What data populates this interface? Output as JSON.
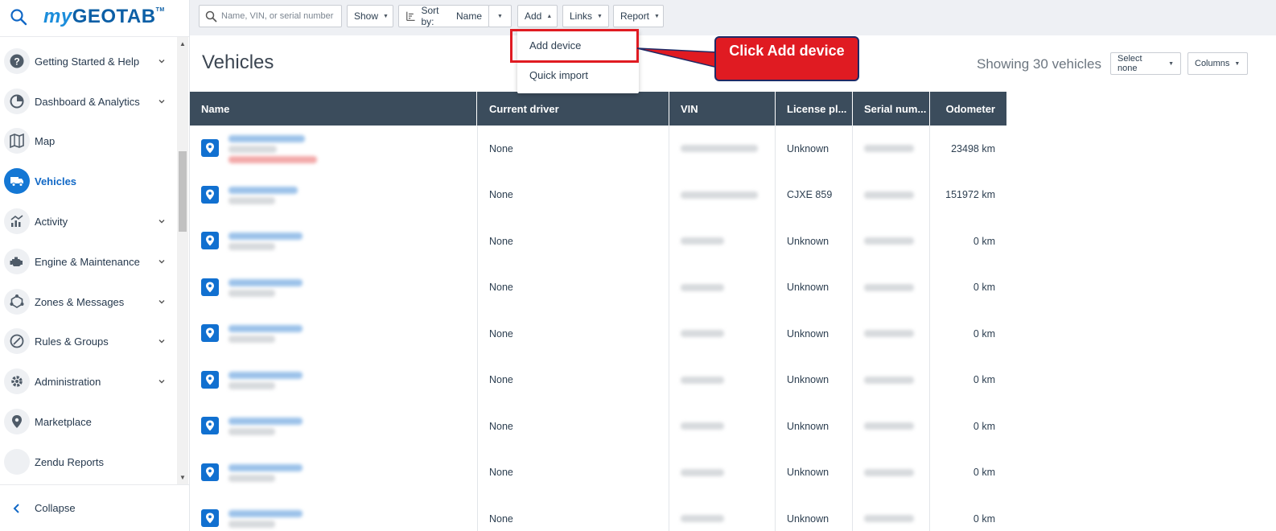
{
  "app": {
    "logo_prefix": "my",
    "logo_main": "GEOTAB",
    "logo_tm": "TM"
  },
  "sidebar": {
    "items": [
      {
        "label": "Getting Started & Help",
        "icon": "help-icon",
        "chevron": true
      },
      {
        "label": "Dashboard & Analytics",
        "icon": "pie-chart-icon",
        "chevron": true
      },
      {
        "label": "Map",
        "icon": "map-icon",
        "chevron": false
      },
      {
        "label": "Vehicles",
        "icon": "truck-icon",
        "chevron": false,
        "active": true
      },
      {
        "label": "Activity",
        "icon": "activity-chart-icon",
        "chevron": true
      },
      {
        "label": "Engine & Maintenance",
        "icon": "engine-icon",
        "chevron": true
      },
      {
        "label": "Zones & Messages",
        "icon": "zones-icon",
        "chevron": true
      },
      {
        "label": "Rules & Groups",
        "icon": "rules-icon",
        "chevron": true
      },
      {
        "label": "Administration",
        "icon": "gear-icon",
        "chevron": true
      },
      {
        "label": "Marketplace",
        "icon": "marketplace-icon",
        "chevron": false
      },
      {
        "label": "Zendu Reports",
        "icon": "blank-icon",
        "chevron": false
      }
    ],
    "collapse_label": "Collapse"
  },
  "toolbar": {
    "search_placeholder": "Name, VIN, or serial number",
    "show_label": "Show",
    "sort_prefix": "Sort by:",
    "sort_value": "Name",
    "add_label": "Add",
    "links_label": "Links",
    "report_label": "Report"
  },
  "add_menu": {
    "items": [
      "Add device",
      "Quick import"
    ]
  },
  "callout": {
    "text": "Click Add device",
    "color": "#e01b22"
  },
  "page": {
    "title": "Vehicles",
    "showing": "Showing 30 vehicles",
    "select_none_label": "Select none",
    "columns_label": "Columns"
  },
  "table": {
    "headers": [
      "Name",
      "Current driver",
      "VIN",
      "License pl...",
      "Serial num...",
      "Odometer"
    ],
    "rows": [
      {
        "driver": "None",
        "plate": "Unknown",
        "odometer": "23498 km"
      },
      {
        "driver": "None",
        "plate": "CJXE 859",
        "odometer": "151972 km"
      },
      {
        "driver": "None",
        "plate": "Unknown",
        "odometer": "0 km"
      },
      {
        "driver": "None",
        "plate": "Unknown",
        "odometer": "0 km"
      },
      {
        "driver": "None",
        "plate": "Unknown",
        "odometer": "0 km"
      },
      {
        "driver": "None",
        "plate": "Unknown",
        "odometer": "0 km"
      },
      {
        "driver": "None",
        "plate": "Unknown",
        "odometer": "0 km"
      },
      {
        "driver": "None",
        "plate": "Unknown",
        "odometer": "0 km"
      },
      {
        "driver": "None",
        "plate": "Unknown",
        "odometer": "0 km"
      }
    ]
  },
  "colors": {
    "accent": "#1477d4",
    "header": "#3b4c5c",
    "highlight": "#e01b22"
  }
}
